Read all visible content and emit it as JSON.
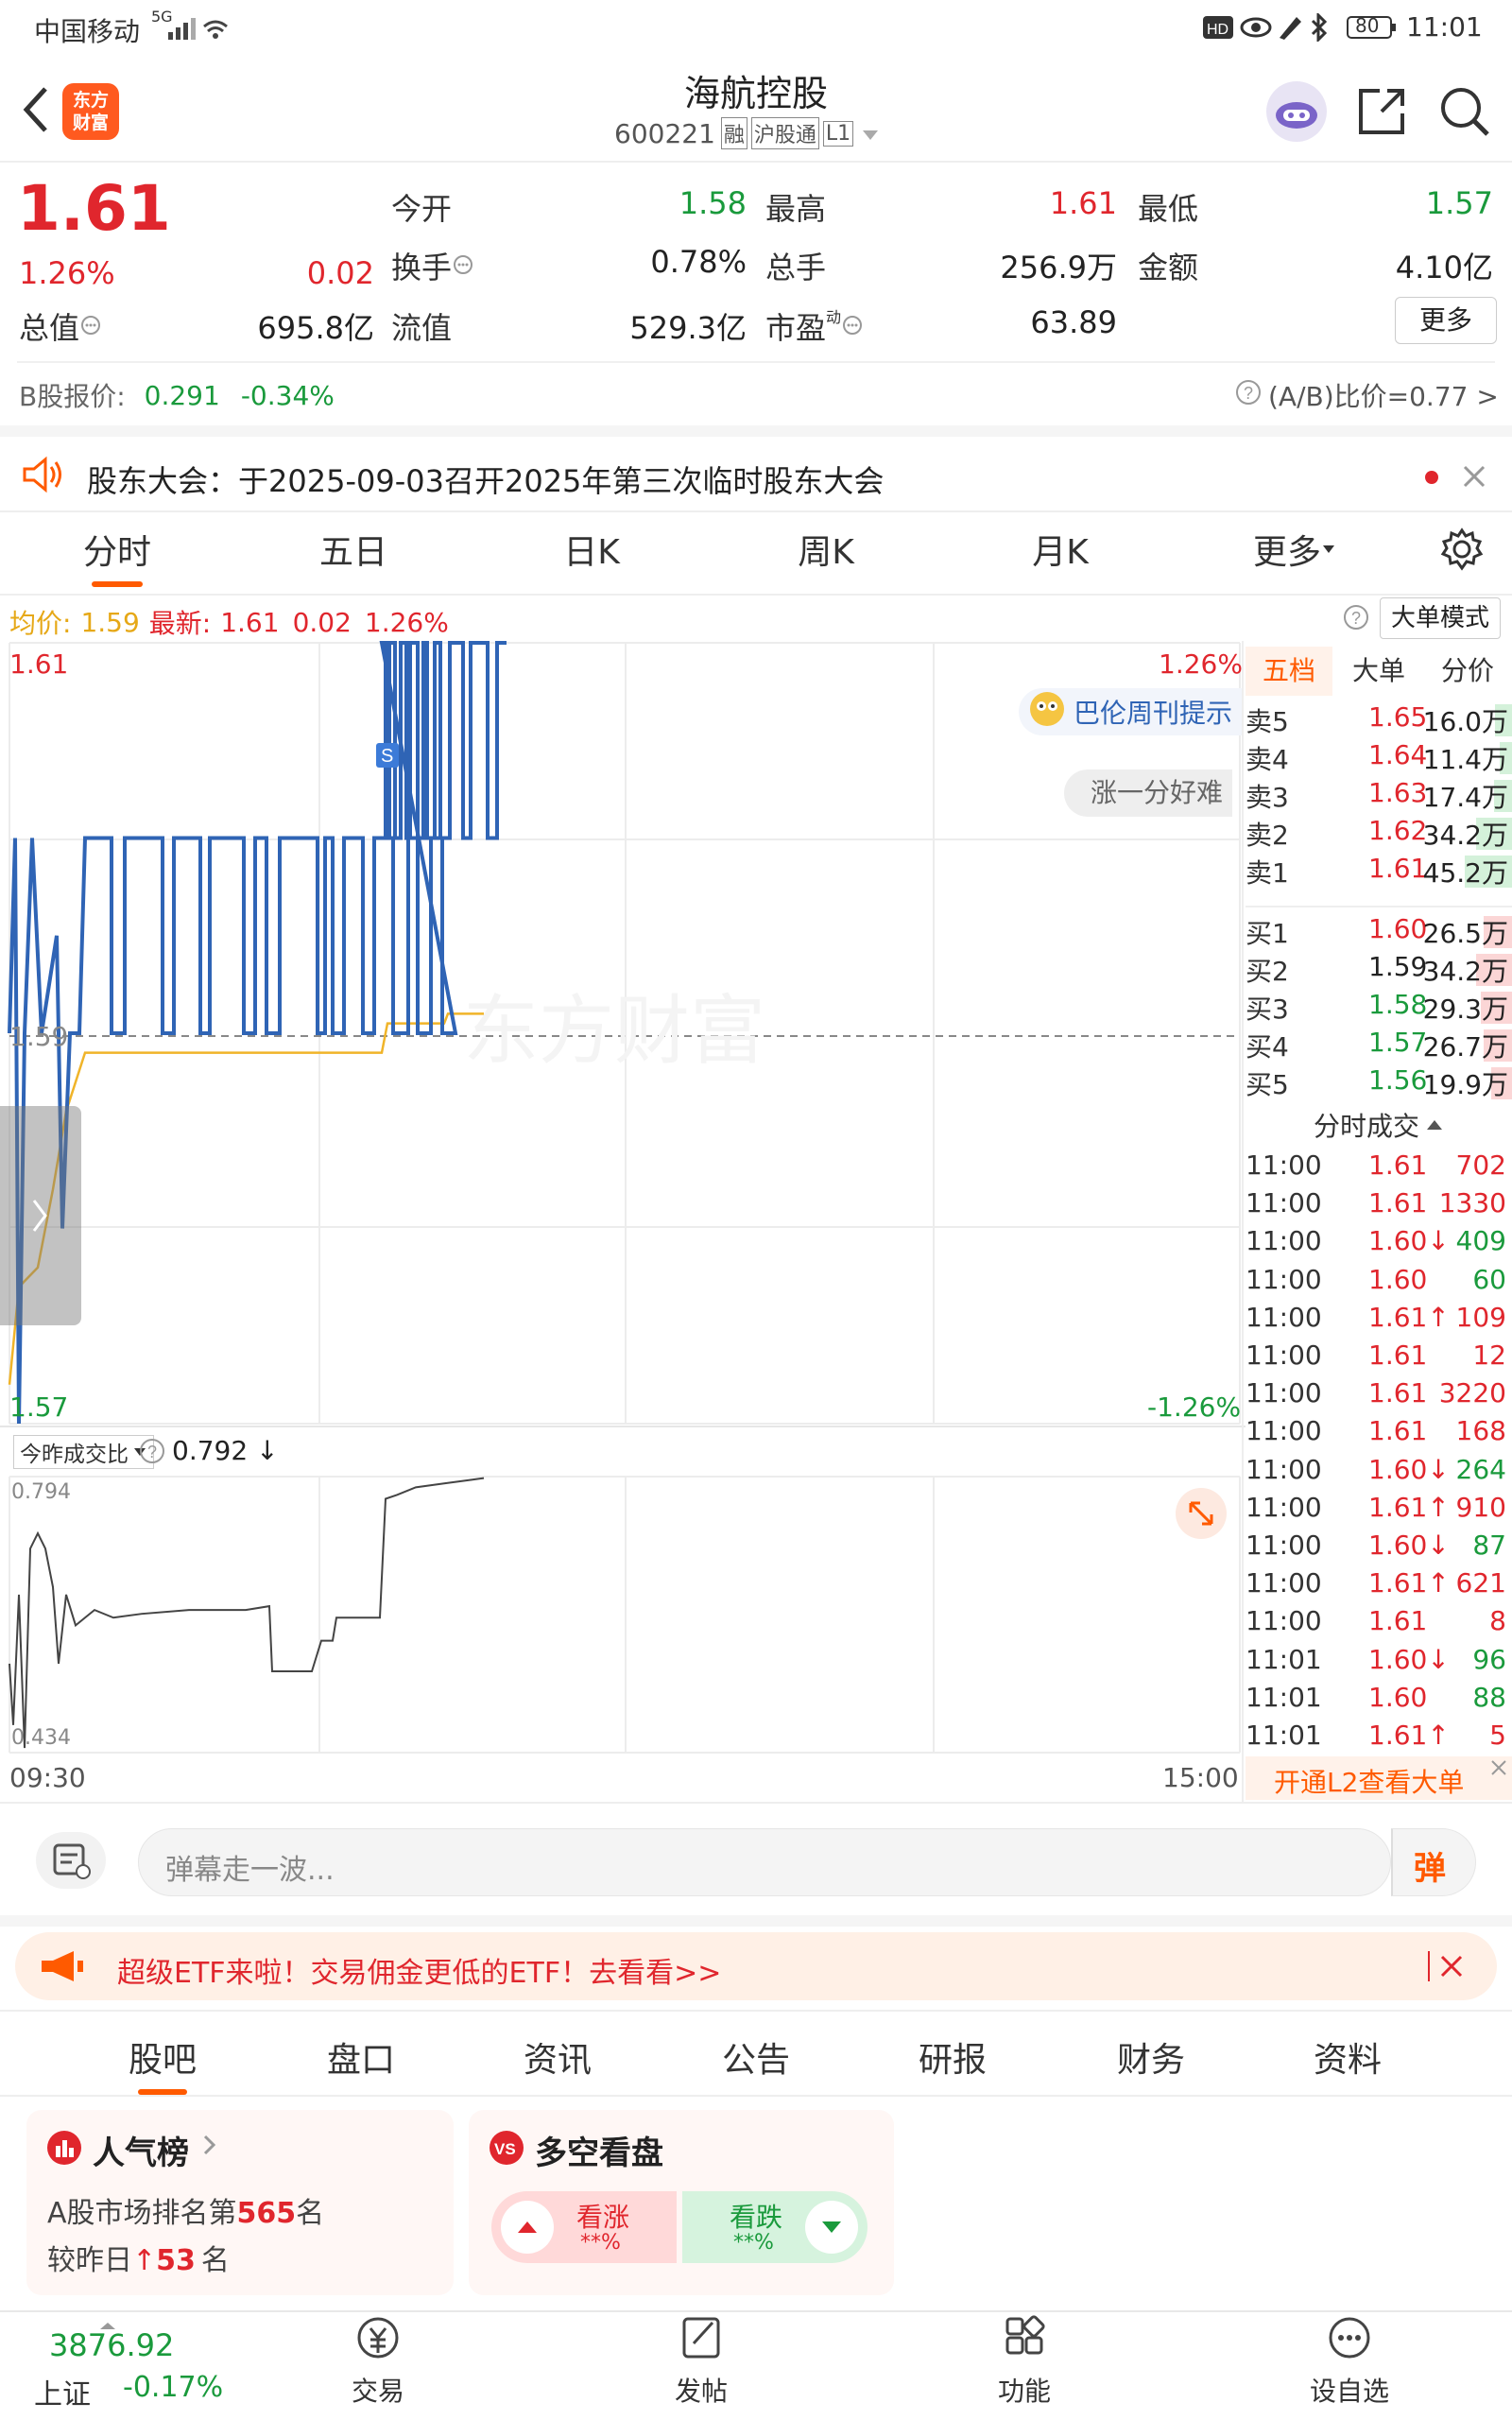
{
  "status": {
    "carrier": "中国移动",
    "signal": "5G",
    "battery": "80",
    "time": "11:01"
  },
  "header": {
    "title": "海航控股",
    "code": "600221",
    "badges": [
      "融",
      "沪股通",
      "L1"
    ],
    "logo_line1": "东方",
    "logo_line2": "财富"
  },
  "quote": {
    "price": "1.61",
    "change_pct": "1.26%",
    "change": "0.02",
    "rows": [
      [
        {
          "label": "今开",
          "value": "1.58",
          "color": "green"
        },
        {
          "label": "最高",
          "value": "1.61",
          "color": "red"
        },
        {
          "label": "最低",
          "value": "1.57",
          "color": "green"
        }
      ],
      [
        {
          "label": "换手",
          "value": "0.78%",
          "color": "normal"
        },
        {
          "label": "总手",
          "value": "256.9万",
          "color": "normal"
        },
        {
          "label": "金额",
          "value": "4.10亿",
          "color": "normal"
        }
      ],
      [
        {
          "label": "流值",
          "value": "529.3亿",
          "color": "normal"
        },
        {
          "label": "市盈",
          "value": "63.89",
          "color": "normal"
        }
      ]
    ],
    "total_value_label": "总值",
    "total_value": "695.8亿",
    "pe_sup": "动",
    "more_button": "更多"
  },
  "bshare": {
    "label": "B股报价:",
    "price": "0.291",
    "change": "-0.34%",
    "ratio": "(A/B)比价=0.77 >"
  },
  "notice": {
    "text": "股东大会：于2025-09-03召开2025年第三次临时股东大会"
  },
  "chart_tabs": [
    "分时",
    "五日",
    "日K",
    "周K",
    "月K",
    "更多"
  ],
  "info_line": {
    "avg_label": "均价:",
    "avg": "1.59",
    "latest_label": "最新:",
    "latest": "1.61",
    "change": "0.02",
    "pct": "1.26%",
    "mode": "大单模式"
  },
  "chart_labels": {
    "top_left": "1.61",
    "top_right": "1.26%",
    "mid_left": "1.59",
    "bottom_left": "1.57",
    "bottom_right": "-1.26%",
    "watermark": "东方财富",
    "promo": "巴伦周刊提示",
    "bubble": "涨一分好难",
    "s_marker": "S"
  },
  "volume_chart": {
    "label": "今昨成交比",
    "value": "0.792",
    "top": "0.794",
    "bottom": "0.434",
    "time_start": "09:30",
    "time_end": "15:00"
  },
  "book_tabs": [
    "五档",
    "大单",
    "分价"
  ],
  "asks": [
    {
      "label": "卖5",
      "price": "1.65",
      "vol": "16.0万",
      "frac": 0.35
    },
    {
      "label": "卖4",
      "price": "1.64",
      "vol": "11.4万",
      "frac": 0.25
    },
    {
      "label": "卖3",
      "price": "1.63",
      "vol": "17.4万",
      "frac": 0.38
    },
    {
      "label": "卖2",
      "price": "1.62",
      "vol": "34.2万",
      "frac": 0.76
    },
    {
      "label": "卖1",
      "price": "1.61",
      "vol": "45.2万",
      "frac": 1.0
    }
  ],
  "bids": [
    {
      "label": "买1",
      "price": "1.60",
      "vol": "26.5万",
      "frac": 0.59,
      "pc": "red"
    },
    {
      "label": "买2",
      "price": "1.59",
      "vol": "34.2万",
      "frac": 0.76,
      "pc": "normal"
    },
    {
      "label": "买3",
      "price": "1.58",
      "vol": "29.3万",
      "frac": 0.65,
      "pc": "green"
    },
    {
      "label": "买4",
      "price": "1.57",
      "vol": "26.7万",
      "frac": 0.59,
      "pc": "green"
    },
    {
      "label": "买5",
      "price": "1.56",
      "vol": "19.9万",
      "frac": 0.44,
      "pc": "green"
    }
  ],
  "ticks_title": "分时成交",
  "ticks": [
    {
      "t": "11:00",
      "p": "1.61",
      "v": "702",
      "pc": "red",
      "vc": "red"
    },
    {
      "t": "11:00",
      "p": "1.61",
      "v": "1330",
      "pc": "red",
      "vc": "red"
    },
    {
      "t": "11:00",
      "p": "1.60↓",
      "v": "409",
      "pc": "red",
      "vc": "green"
    },
    {
      "t": "11:00",
      "p": "1.60",
      "v": "60",
      "pc": "red",
      "vc": "green"
    },
    {
      "t": "11:00",
      "p": "1.61↑",
      "v": "109",
      "pc": "red",
      "vc": "red"
    },
    {
      "t": "11:00",
      "p": "1.61",
      "v": "12",
      "pc": "red",
      "vc": "red"
    },
    {
      "t": "11:00",
      "p": "1.61",
      "v": "3220",
      "pc": "red",
      "vc": "red"
    },
    {
      "t": "11:00",
      "p": "1.61",
      "v": "168",
      "pc": "red",
      "vc": "red"
    },
    {
      "t": "11:00",
      "p": "1.60↓",
      "v": "264",
      "pc": "red",
      "vc": "green"
    },
    {
      "t": "11:00",
      "p": "1.61↑",
      "v": "910",
      "pc": "red",
      "vc": "red"
    },
    {
      "t": "11:00",
      "p": "1.60↓",
      "v": "87",
      "pc": "red",
      "vc": "green"
    },
    {
      "t": "11:00",
      "p": "1.61↑",
      "v": "621",
      "pc": "red",
      "vc": "red"
    },
    {
      "t": "11:00",
      "p": "1.61",
      "v": "8",
      "pc": "red",
      "vc": "red"
    },
    {
      "t": "11:01",
      "p": "1.60↓",
      "v": "96",
      "pc": "red",
      "vc": "green"
    },
    {
      "t": "11:01",
      "p": "1.60",
      "v": "88",
      "pc": "red",
      "vc": "green"
    },
    {
      "t": "11:01",
      "p": "1.61↑",
      "v": "5",
      "pc": "red",
      "vc": "red"
    }
  ],
  "l2_link": "开通L2查看大单",
  "danmaku": {
    "placeholder": "弹幕走一波...",
    "button": "弹"
  },
  "etf_banner": {
    "text": "超级ETF来啦！交易佣金更低的ETF！去看看>>"
  },
  "bottom_tabs": [
    "股吧",
    "盘口",
    "资讯",
    "公告",
    "研报",
    "财务",
    "资料"
  ],
  "popularity": {
    "title": "人气榜",
    "line1_a": "A股市场排名第",
    "rank": "565",
    "line1_b": "名",
    "line2_a": "较昨日",
    "delta": "53",
    "line2_b": "名"
  },
  "bullbear": {
    "title": "多空看盘",
    "up": "看涨",
    "down": "看跌",
    "up_pct": "**%",
    "down_pct": "**%"
  },
  "bottom_nav": {
    "index_value": "3876.92",
    "index_name": "上证",
    "index_change": "-0.17%",
    "items": [
      "交易",
      "发帖",
      "功能",
      "设自选"
    ]
  },
  "chart_data": {
    "type": "line",
    "x": [
      "09:30",
      "15:00"
    ],
    "series": [
      {
        "values": [
          1.57,
          1.58,
          1.59,
          1.6,
          1.61,
          1.6,
          1.61,
          1.61
        ]
      }
    ],
    "ylim": [
      1.57,
      1.61
    ]
  }
}
